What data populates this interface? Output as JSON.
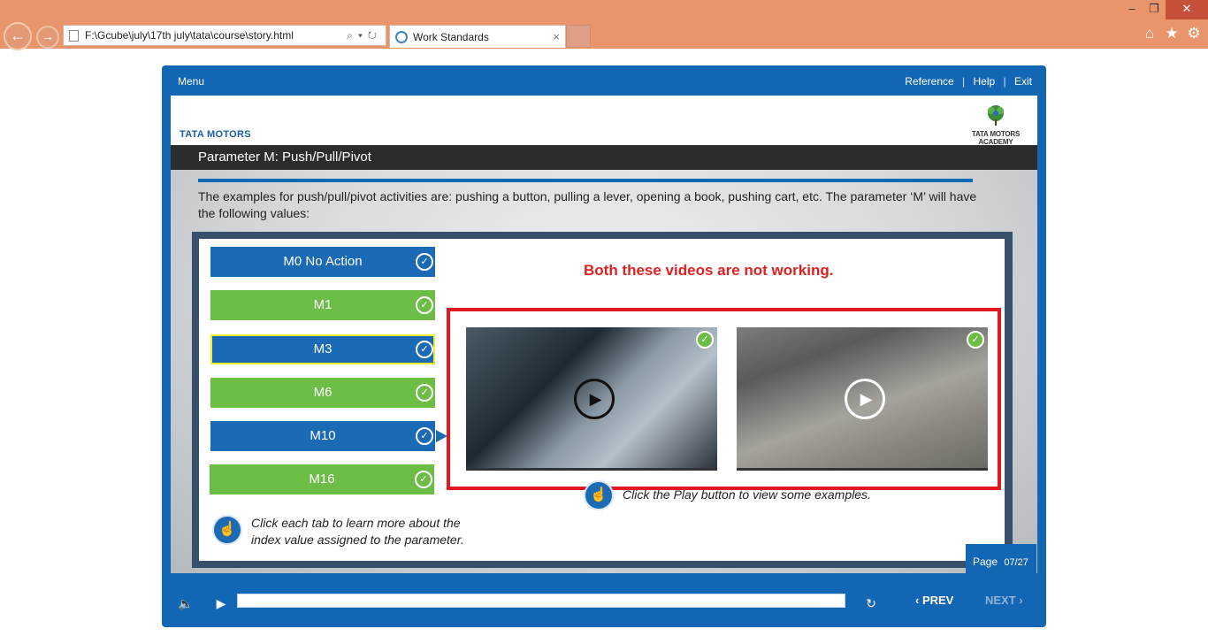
{
  "browser": {
    "address": "F:\\Gcube\\july\\17th july\\tata\\course\\story.html",
    "tab_title": "Work Standards",
    "tab_close": "×",
    "back_glyph": "←",
    "forward_glyph": "→",
    "address_tools": "⌕▾↻",
    "min_glyph": "–",
    "max_glyph": "❐",
    "close_glyph": "✕",
    "home_glyph": "⌂",
    "fav_glyph": "★",
    "settings_glyph": "⚙"
  },
  "player": {
    "menu_label": "Menu",
    "links": {
      "reference": "Reference",
      "help": "Help",
      "exit": "Exit"
    },
    "separator": "|",
    "brand_logo": "TATA MOTORS",
    "academy_logo": "TATA MOTORS ACADEMY",
    "slide_title": "Parameter M: Push/Pull/Pivot",
    "description": "The examples for push/pull/pivot activities are: pushing a button, pulling a lever, opening a book, pushing cart, etc. The parameter ‘M’ will have the following values:",
    "tabs": [
      {
        "label": "M0 No Action",
        "color": "#1a6ab6",
        "state": "visited"
      },
      {
        "label": "M1",
        "color": "#6cbd45",
        "state": "visited"
      },
      {
        "label": "M3",
        "color": "#1a6ab6",
        "state": "selected"
      },
      {
        "label": "M6",
        "color": "#6cbd45",
        "state": "visited"
      },
      {
        "label": "M10",
        "color": "#1a6ab6",
        "state": "active"
      },
      {
        "label": "M16",
        "color": "#6cbd45",
        "state": "visited"
      }
    ],
    "check_glyph": "✓",
    "hint_left": "Click each tab to learn more about the index value assigned to the parameter.",
    "hint_right": "Click the Play button to view some examples.",
    "warning": "Both these videos are not working.",
    "warning_color": "#e02020",
    "videos": [
      {
        "name": "video-gear-lever",
        "play_glyph": "▶"
      },
      {
        "name": "video-cart",
        "play_glyph": "▶"
      }
    ],
    "page_label": "Page",
    "page_value": "07/27",
    "controls": {
      "volume_glyph": "🔈",
      "play_glyph": "▶",
      "replay_glyph": "↻",
      "prev_label": "‹  PREV",
      "next_label": "NEXT  ›"
    },
    "accent_blue": "#1366b3",
    "accent_green": "#6cbd45"
  }
}
